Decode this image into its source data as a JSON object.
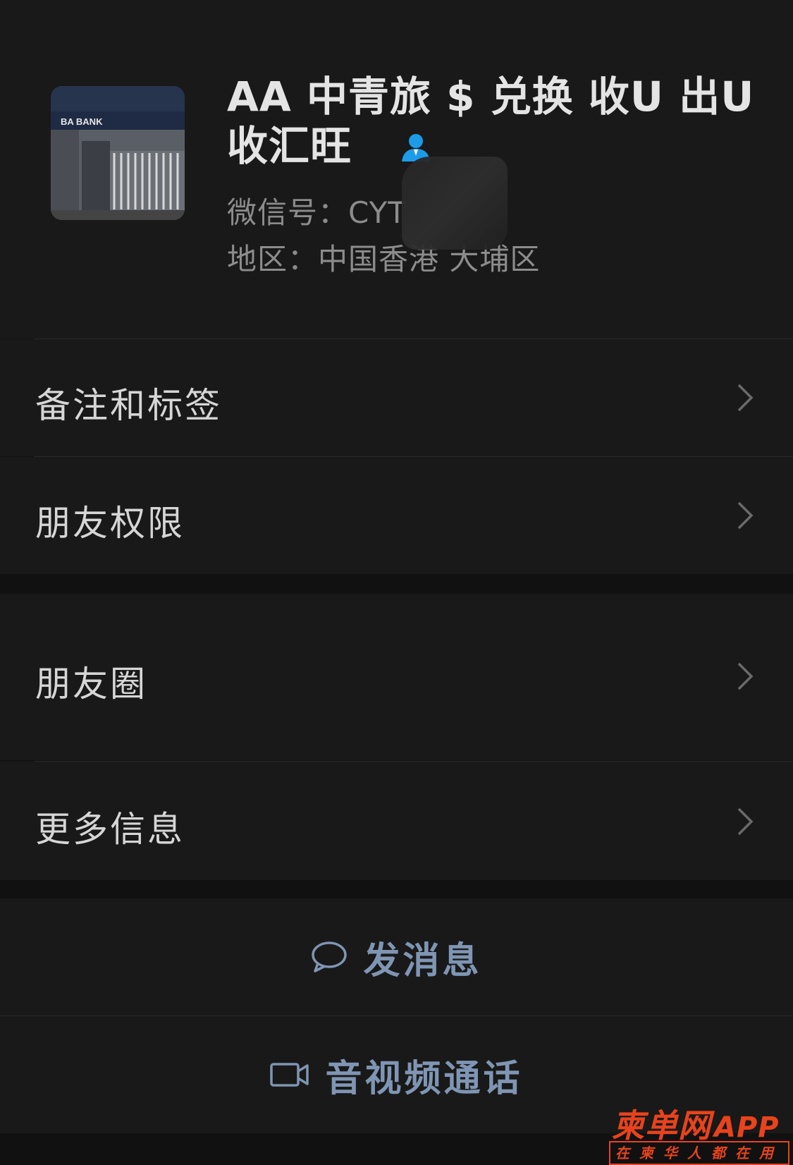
{
  "profile": {
    "name": "AA 中青旅 $ 兑换 收U 出U 收汇旺",
    "wechat_id": "微信号：CYT",
    "region": "地区：中国香港 大埔区",
    "avatar_sign": "BA BANK"
  },
  "menu": {
    "remark_tags": "备注和标签",
    "friend_permissions": "朋友权限",
    "moments": "朋友圈",
    "more_info": "更多信息"
  },
  "actions": {
    "send_message": "发消息",
    "av_call": "音视频通话"
  },
  "watermark": {
    "brand": "柬单网",
    "app": "APP",
    "tagline": "在柬华人都在用"
  },
  "colors": {
    "background": "#111111",
    "card": "#191919",
    "action_text": "#7f95b3",
    "watermark": "#e8431c",
    "contact_icon": "#1e9be8"
  }
}
